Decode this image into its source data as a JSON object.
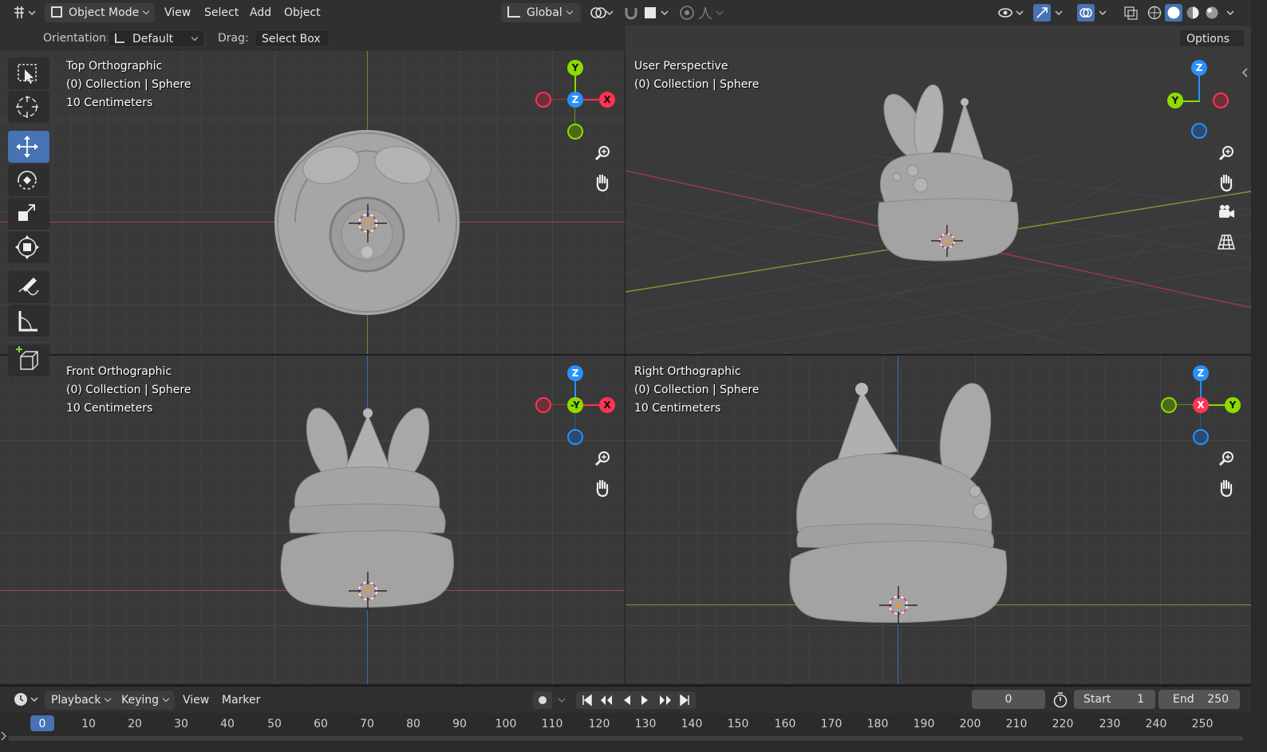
{
  "header": {
    "editor_icon": "editor-type-icon",
    "mode": "Object Mode",
    "menus": [
      "View",
      "Select",
      "Add",
      "Object"
    ],
    "transform_orientation": "Global",
    "options_label": "Options"
  },
  "tool_settings": {
    "orientation_label": "Orientation:",
    "orientation_value": "Default",
    "drag_label": "Drag:",
    "drag_value": "Select Box"
  },
  "viewports": {
    "top": {
      "title": "Top Orthographic",
      "collection": "(0) Collection | Sphere",
      "scale": "10 Centimeters",
      "gizmo": {
        "up": "Y",
        "center": "Z",
        "right": "X"
      }
    },
    "user": {
      "title": "User Perspective",
      "collection": "(0) Collection | Sphere",
      "gizmo": {
        "up": "Z",
        "left": "Y"
      }
    },
    "front": {
      "title": "Front Orthographic",
      "collection": "(0) Collection | Sphere",
      "scale": "10 Centimeters",
      "gizmo": {
        "up": "Z",
        "center": "-Y",
        "right": "X"
      }
    },
    "right": {
      "title": "Right Orthographic",
      "collection": "(0) Collection | Sphere",
      "scale": "10 Centimeters",
      "gizmo": {
        "up": "Z",
        "center": "X",
        "right": "Y"
      }
    }
  },
  "toolbar": {
    "tools": [
      "select-box",
      "cursor",
      "move",
      "rotate",
      "scale",
      "transform",
      "annotate",
      "measure",
      "add-cube"
    ],
    "active_tool": "move"
  },
  "timeline": {
    "menus": [
      "Playback",
      "Keying",
      "View",
      "Marker"
    ],
    "current_frame": "0",
    "start_label": "Start",
    "start_value": "1",
    "end_label": "End",
    "end_value": "250",
    "ticks": [
      "0",
      "10",
      "20",
      "30",
      "40",
      "50",
      "60",
      "70",
      "80",
      "90",
      "100",
      "110",
      "120",
      "130",
      "140",
      "150",
      "160",
      "170",
      "180",
      "190",
      "200",
      "210",
      "220",
      "230",
      "240",
      "250"
    ]
  },
  "colors": {
    "accent": "#4772b3",
    "axis_x": "#ff3352",
    "axis_y": "#8bdc00",
    "axis_z": "#2890ff",
    "model": "#a8a8a8"
  }
}
